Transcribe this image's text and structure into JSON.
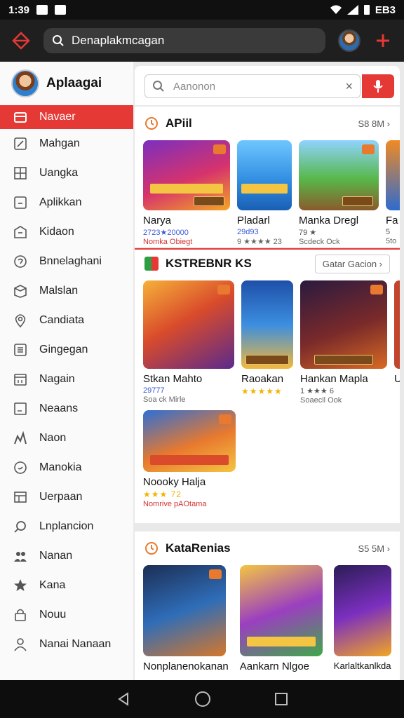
{
  "status": {
    "time": "1:39",
    "battery_text": "EB3"
  },
  "topbar": {
    "search_text": "Denaplakmcagan"
  },
  "sidebar": {
    "title": "Aplaagai",
    "items": [
      {
        "label": "Navaer",
        "icon": "store-icon",
        "active": true
      },
      {
        "label": "Mahgan",
        "icon": "edit-icon"
      },
      {
        "label": "Uangka",
        "icon": "grid-icon"
      },
      {
        "label": "Aplikkan",
        "icon": "app-icon"
      },
      {
        "label": "Kidaon",
        "icon": "building-icon"
      },
      {
        "label": "Bnnelaghani",
        "icon": "refresh-icon"
      },
      {
        "label": "Malslan",
        "icon": "box-icon"
      },
      {
        "label": "Candiata",
        "icon": "location-icon"
      },
      {
        "label": "Gingegan",
        "icon": "list-icon"
      },
      {
        "label": "Nagain",
        "icon": "calendar-icon"
      },
      {
        "label": "Neaans",
        "icon": "note-icon"
      },
      {
        "label": "Naon",
        "icon": "chart-icon"
      },
      {
        "label": "Manokia",
        "icon": "clock-icon"
      },
      {
        "label": "Uerpaan",
        "icon": "table-icon"
      },
      {
        "label": "Lnplancion",
        "icon": "search-icon"
      },
      {
        "label": "Nanan",
        "icon": "people-icon"
      },
      {
        "label": "Kana",
        "icon": "star-icon"
      },
      {
        "label": "Nouu",
        "icon": "lock-icon"
      },
      {
        "label": "Nanai Nanaan",
        "icon": "person-icon"
      }
    ]
  },
  "main": {
    "search_placeholder": "Aanonon",
    "sections": [
      {
        "title": "APiil",
        "more": "S8 8M ›",
        "cards": [
          {
            "name": "Narya",
            "sub1": "2723★20000",
            "sub2": "Nomka Obiegt"
          },
          {
            "name": "Pladarl",
            "sub1": "29d93",
            "sub2": "9 ★★★★ 23"
          },
          {
            "name": "Manka Dregl",
            "sub1": "79 ★",
            "sub2": "Scdeck Ock"
          },
          {
            "name": "Fa",
            "sub1": "5",
            "sub2": "5to"
          }
        ]
      },
      {
        "title": "KSTREBNR KS",
        "button": "Gatar Gacion ›",
        "cards": [
          {
            "name": "Stkan Mahto",
            "sub1": "29777",
            "sub2": "Soa ck Mirle"
          },
          {
            "name": "Raoakan",
            "sub1": "★★★★★",
            "sub2": ""
          },
          {
            "name": "Hankan Mapla",
            "sub1": "1 ★★★ 6",
            "sub2": "Soaecll Ook"
          },
          {
            "name": "U",
            "sub1": "",
            "sub2": ""
          },
          {
            "name": "Noooky Halja",
            "sub1": "★★★ 72",
            "sub2": "Nomrive pAOtama"
          }
        ]
      },
      {
        "title": "KataRenias",
        "more": "S5 5M ›",
        "cards": [
          {
            "name": "Nonplanenokanan"
          },
          {
            "name": "Aankarn Nlgoe"
          },
          {
            "name": "Karlaltkanlkda"
          }
        ]
      }
    ]
  }
}
